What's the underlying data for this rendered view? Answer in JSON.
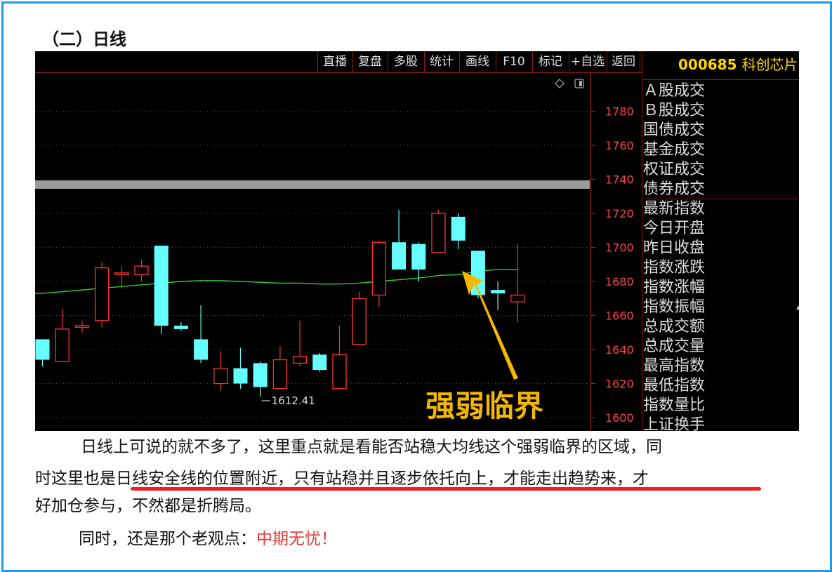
{
  "heading": "（二）日线",
  "toolbar": {
    "buttons": [
      "直播",
      "复盘",
      "多股",
      "统计",
      "画线",
      "F10",
      "标记",
      "+自选",
      "返回"
    ],
    "stock_code": "000685",
    "stock_name": "科创芯片"
  },
  "sidebar": {
    "items": [
      "Ａ股成交",
      "Ｂ股成交",
      "国债成交",
      "基金成交",
      "权证成交",
      "债券成交",
      "最新指数",
      "今日开盘",
      "昨日收盘",
      "指数涨跌",
      "指数涨幅",
      "指数振幅",
      "总成交额",
      "总成交量",
      "最高指数",
      "最低指数",
      "指数量比",
      "上证换手"
    ]
  },
  "colors": {
    "up": "#ff3333",
    "down": "#66ffff",
    "ma": "#33cc33",
    "annotation": "#f5b800",
    "axis": "#b22222"
  },
  "chart_data": {
    "type": "candlestick",
    "y_ticks": [
      1600,
      1620,
      1640,
      1660,
      1680,
      1700,
      1720,
      1740,
      1760,
      1780
    ],
    "ylim": [
      1596,
      1798
    ],
    "low_label": "1612.41",
    "annotation": "强弱临界",
    "candles": [
      {
        "o": 1646,
        "c": 1634,
        "h": 1646,
        "l": 1630
      },
      {
        "o": 1633,
        "c": 1652,
        "h": 1664,
        "l": 1633
      },
      {
        "o": 1653,
        "c": 1654,
        "h": 1657,
        "l": 1650
      },
      {
        "o": 1657,
        "c": 1688,
        "h": 1691,
        "l": 1653
      },
      {
        "o": 1684,
        "c": 1685,
        "h": 1689,
        "l": 1676
      },
      {
        "o": 1684,
        "c": 1689,
        "h": 1693,
        "l": 1680
      },
      {
        "o": 1701,
        "c": 1654,
        "h": 1701,
        "l": 1649
      },
      {
        "o": 1654,
        "c": 1652,
        "h": 1656,
        "l": 1651
      },
      {
        "o": 1646,
        "c": 1634,
        "h": 1666,
        "l": 1632
      },
      {
        "o": 1620,
        "c": 1629,
        "h": 1639,
        "l": 1616
      },
      {
        "o": 1629,
        "c": 1620,
        "h": 1641,
        "l": 1617
      },
      {
        "o": 1632,
        "c": 1618,
        "h": 1633,
        "l": 1612.41
      },
      {
        "o": 1617,
        "c": 1634,
        "h": 1642,
        "l": 1617
      },
      {
        "o": 1632,
        "c": 1636,
        "h": 1657,
        "l": 1630
      },
      {
        "o": 1637,
        "c": 1628,
        "h": 1638,
        "l": 1627
      },
      {
        "o": 1617,
        "c": 1637,
        "h": 1654,
        "l": 1617
      },
      {
        "o": 1643,
        "c": 1670,
        "h": 1674,
        "l": 1643
      },
      {
        "o": 1672,
        "c": 1703,
        "h": 1704,
        "l": 1665
      },
      {
        "o": 1703,
        "c": 1687,
        "h": 1722,
        "l": 1687
      },
      {
        "o": 1702,
        "c": 1687,
        "h": 1703,
        "l": 1680
      },
      {
        "o": 1697,
        "c": 1720,
        "h": 1722,
        "l": 1697
      },
      {
        "o": 1718,
        "c": 1704,
        "h": 1720,
        "l": 1699
      },
      {
        "o": 1698,
        "c": 1672,
        "h": 1698,
        "l": 1670
      },
      {
        "o": 1675,
        "c": 1673,
        "h": 1680,
        "l": 1663
      },
      {
        "o": 1668,
        "c": 1672,
        "h": 1702,
        "l": 1656
      }
    ],
    "ma": [
      1673,
      1674,
      1675,
      1676,
      1677,
      1678,
      1679,
      1680,
      1680.5,
      1680.5,
      1680,
      1679.5,
      1679,
      1679,
      1678.5,
      1678.5,
      1679,
      1680,
      1681,
      1682,
      1683.5,
      1684,
      1686,
      1687,
      1687
    ]
  },
  "paragraphs": {
    "p1_line1": "日线上可说的就不多了，这里重点就是看能否站稳大均线这个强弱临界的区域，同",
    "p1_line2": "时这里也是日线安全线的位置附近，只有站稳并且逐步依托向上，才能走出趋势来，才",
    "p1_line3": "好加仓参与，不然都是折腾局。",
    "p2_prefix": "同时，还是那个老观点：",
    "p2_highlight": "中期无忧！"
  }
}
